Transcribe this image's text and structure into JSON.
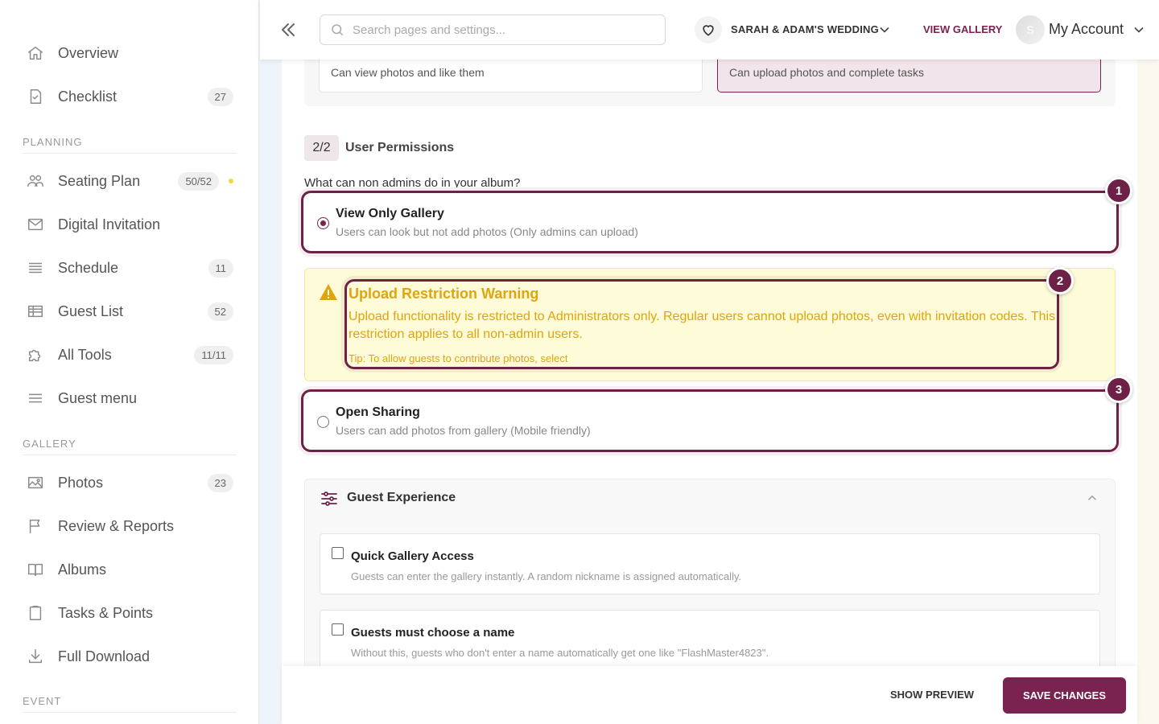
{
  "sidebar": {
    "items": [
      {
        "label": "Overview",
        "badge": "",
        "icon": "home-icon"
      },
      {
        "label": "Checklist",
        "badge": "27",
        "icon": "checklist-icon"
      }
    ],
    "sections": [
      {
        "title": "PLANNING",
        "items": [
          {
            "label": "Seating Plan",
            "badge": "50/52",
            "icon": "people-icon"
          },
          {
            "label": "Digital Invitation",
            "badge": "",
            "icon": "envelope-icon"
          },
          {
            "label": "Schedule",
            "badge": "11",
            "icon": "list-icon"
          },
          {
            "label": "Guest List",
            "badge": "52",
            "icon": "table-icon"
          },
          {
            "label": "All Tools",
            "badge": "11/11",
            "icon": "puzzle-icon"
          },
          {
            "label": "Guest menu",
            "badge": "",
            "icon": "menu-icon"
          }
        ]
      },
      {
        "title": "GALLERY",
        "items": [
          {
            "label": "Photos",
            "badge": "23",
            "icon": "image-icon"
          },
          {
            "label": "Review & Reports",
            "badge": "",
            "icon": "flag-icon"
          },
          {
            "label": "Albums",
            "badge": "",
            "icon": "book-icon"
          },
          {
            "label": "Tasks & Points",
            "badge": "",
            "icon": "clipboard-icon"
          },
          {
            "label": "Full Download",
            "badge": "",
            "icon": "download-icon"
          }
        ]
      },
      {
        "title": "EVENT",
        "items": []
      }
    ]
  },
  "header": {
    "search_placeholder": "Search pages and settings...",
    "event_name": "SARAH & ADAM'S WEDDING",
    "view_gallery": "VIEW GALLERY",
    "avatar_initial": "S",
    "account_label": "My Account"
  },
  "roles": {
    "viewer_desc": "Can view photos and like them",
    "contributor_desc": "Can upload photos and complete tasks"
  },
  "permissions": {
    "step": "2/2",
    "title": "User Permissions",
    "question": "What can non admins do in your album?",
    "options": [
      {
        "title": "View Only Gallery",
        "desc": "Users can look but not add photos (Only admins can upload)",
        "selected": true
      },
      {
        "title": "Open Sharing",
        "desc": "Users can add photos from gallery (Mobile friendly)",
        "selected": false
      }
    ],
    "warning": {
      "title": "Upload Restriction Warning",
      "body": "Upload functionality is restricted to Administrators only. Regular users cannot upload photos, even with invitation codes. This restriction applies to all non-admin users.",
      "tip": "Tip: To allow guests to contribute photos, select"
    },
    "markers": [
      "1",
      "2",
      "3"
    ]
  },
  "guest_experience": {
    "title": "Guest Experience",
    "items": [
      {
        "title": "Quick Gallery Access",
        "desc": "Guests can enter the gallery instantly. A random nickname is assigned automatically.",
        "checked": false
      },
      {
        "title": "Guests must choose a name",
        "desc": "Without this, guests who don't enter a name automatically get one like \"FlashMaster4823\".",
        "checked": false
      }
    ]
  },
  "footer": {
    "show_preview": "SHOW PREVIEW",
    "save_changes": "SAVE CHANGES"
  },
  "colors": {
    "brand": "#7a2350",
    "warning_text": "#e0a40e",
    "warning_bg": "#fefbd8"
  }
}
